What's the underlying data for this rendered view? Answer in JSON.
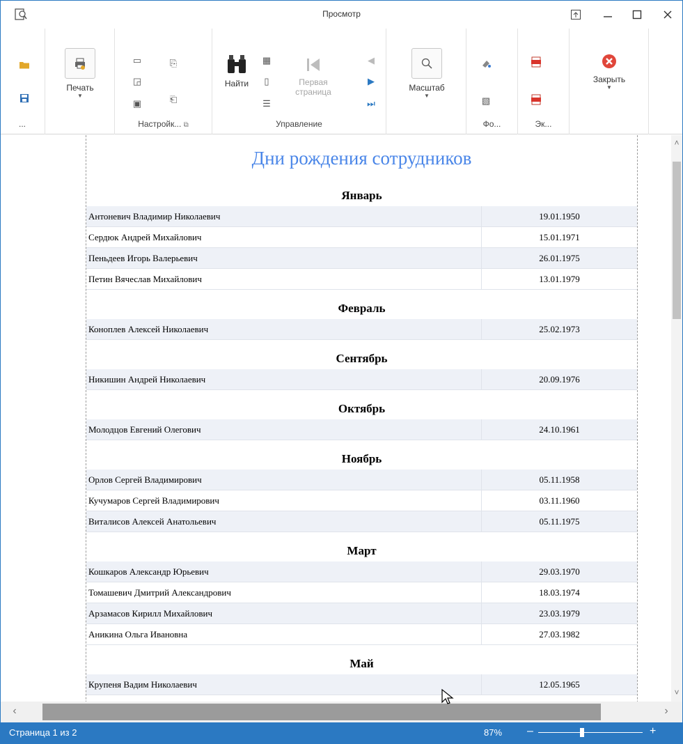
{
  "window": {
    "title": "Просмотр"
  },
  "ribbon": {
    "file_more": "...",
    "print_label": "Печать",
    "settings_group": "Настройк...",
    "find_label": "Найти",
    "first_page_label": "Первая страница",
    "navigation_group": "Управление",
    "zoom_label": "Масштаб",
    "background_group": "Фо...",
    "export_group": "Эк...",
    "close_label": "Закрыть"
  },
  "report": {
    "title": "Дни рождения сотрудников",
    "sections": [
      {
        "month": "Январь",
        "rows": [
          {
            "name": "Антоневич Владимир Николаевич",
            "date": "19.01.1950"
          },
          {
            "name": "Сердюк Андрей Михайлович",
            "date": "15.01.1971"
          },
          {
            "name": "Пеньдеев Игорь Валерьевич",
            "date": "26.01.1975"
          },
          {
            "name": "Петин Вячеслав Михайлович",
            "date": "13.01.1979"
          }
        ]
      },
      {
        "month": "Февраль",
        "rows": [
          {
            "name": "Коноплев Алексей Николаевич",
            "date": "25.02.1973"
          }
        ]
      },
      {
        "month": "Сентябрь",
        "rows": [
          {
            "name": "Никишин Андрей Николаевич",
            "date": "20.09.1976"
          }
        ]
      },
      {
        "month": "Октябрь",
        "rows": [
          {
            "name": "Молодцов Евгений Олегович",
            "date": "24.10.1961"
          }
        ]
      },
      {
        "month": "Ноябрь",
        "rows": [
          {
            "name": "Орлов Сергей Владимирович",
            "date": "05.11.1958"
          },
          {
            "name": "Кучумаров Сергей Владимирович",
            "date": "03.11.1960"
          },
          {
            "name": "Виталисов Алексей Анатольевич",
            "date": "05.11.1975"
          }
        ]
      },
      {
        "month": "Март",
        "rows": [
          {
            "name": "Кошкаров Александр Юрьевич",
            "date": "29.03.1970"
          },
          {
            "name": "Томашевич Дмитрий Александрович",
            "date": "18.03.1974"
          },
          {
            "name": "Арзамасов Кирилл Михайлович",
            "date": "23.03.1979"
          },
          {
            "name": "Аникина Ольга Ивановна",
            "date": "27.03.1982"
          }
        ]
      },
      {
        "month": "Май",
        "rows": [
          {
            "name": "Крупеня Вадим Николаевич",
            "date": "12.05.1965"
          }
        ]
      }
    ]
  },
  "status": {
    "page_info": "Страница 1 из 2",
    "zoom": "87%",
    "zoom_minus": "–",
    "zoom_plus": "+"
  },
  "colors": {
    "accent": "#2b79c2",
    "title_blue": "#4a86e8",
    "row_alt": "#eef1f7",
    "close_red": "#e0463a"
  }
}
